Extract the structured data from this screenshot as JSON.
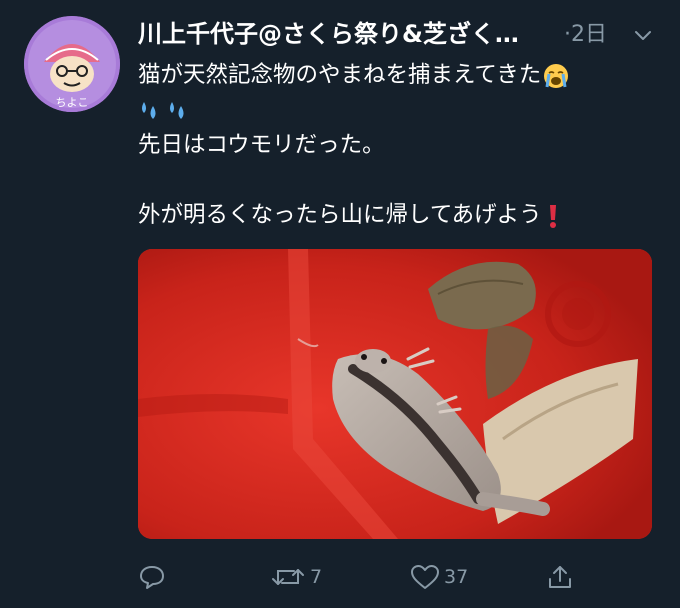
{
  "user": {
    "display_name": "川上千代子@さくら祭り&芝ざく…",
    "timestamp": "·2日",
    "avatar_text": "ちよこ"
  },
  "tweet": {
    "line1": "猫が天然記念物のやまねを捕まえてきた",
    "line2_emoji": "sweat-drops-emoji",
    "line3": "先日はコウモリだった。",
    "line5": "外が明るくなったら山に帰してあげよう",
    "emoji_face": "loudly-crying-face-emoji",
    "emoji_exclaim": "red-exclamation-emoji"
  },
  "media": {
    "description_icon": "photo"
  },
  "actions": {
    "reply_count": "",
    "retweet_count": "7",
    "like_count": "37"
  },
  "colors": {
    "background": "#15202b",
    "muted": "#8899a6",
    "text": "#ffffff",
    "photo_red": "#d52a1c"
  }
}
